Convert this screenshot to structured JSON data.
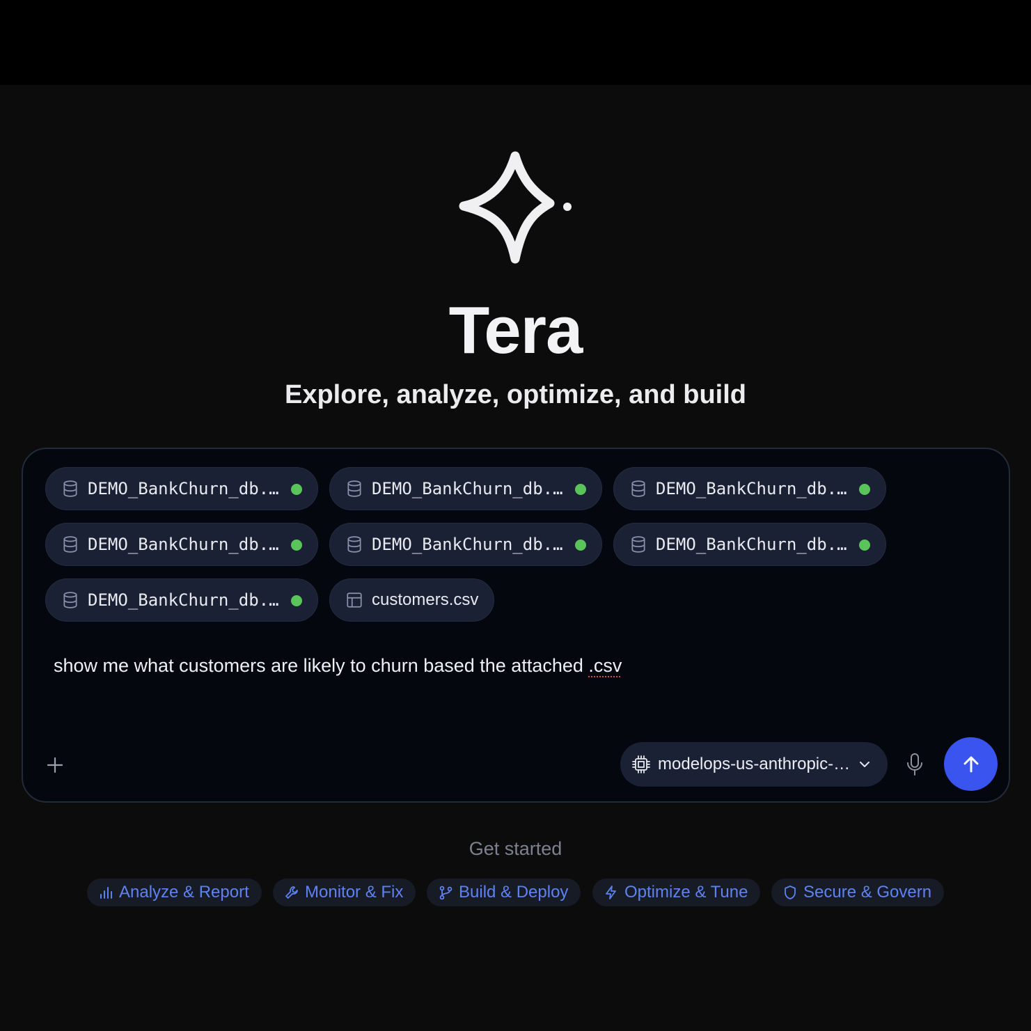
{
  "app": {
    "title": "Tera",
    "subtitle": "Explore, analyze, optimize, and build"
  },
  "composer": {
    "attachments": [
      {
        "type": "database",
        "label": "DEMO_BankChurn_db.…",
        "status": "connected",
        "status_color": "#5ac35a"
      },
      {
        "type": "database",
        "label": "DEMO_BankChurn_db.…",
        "status": "connected",
        "status_color": "#5ac35a"
      },
      {
        "type": "database",
        "label": "DEMO_BankChurn_db.…",
        "status": "connected",
        "status_color": "#5ac35a"
      },
      {
        "type": "database",
        "label": "DEMO_BankChurn_db.…",
        "status": "connected",
        "status_color": "#5ac35a"
      },
      {
        "type": "database",
        "label": "DEMO_BankChurn_db.…",
        "status": "connected",
        "status_color": "#5ac35a"
      },
      {
        "type": "database",
        "label": "DEMO_BankChurn_db.…",
        "status": "connected",
        "status_color": "#5ac35a"
      },
      {
        "type": "database",
        "label": "DEMO_BankChurn_db.…",
        "status": "connected",
        "status_color": "#5ac35a"
      },
      {
        "type": "file",
        "label": "customers.csv"
      }
    ],
    "prompt_text_main": "show me what customers are likely to churn based the attached ",
    "prompt_text_flagged": ".csv",
    "model_label": "modelops-us-anthropic-…",
    "icons": {
      "add": "plus-icon",
      "model": "cpu-icon",
      "model_dropdown": "chevron-down-icon",
      "mic": "microphone-icon",
      "send": "arrow-up-icon"
    },
    "send_color": "#3a55ef"
  },
  "get_started": {
    "heading": "Get started",
    "actions": [
      {
        "label": "Analyze & Report",
        "icon": "bar-chart-icon"
      },
      {
        "label": "Monitor & Fix",
        "icon": "wrench-icon"
      },
      {
        "label": "Build & Deploy",
        "icon": "git-branch-icon"
      },
      {
        "label": "Optimize & Tune",
        "icon": "lightning-icon"
      },
      {
        "label": "Secure & Govern",
        "icon": "shield-icon"
      }
    ],
    "accent_color": "#5f82f3"
  }
}
